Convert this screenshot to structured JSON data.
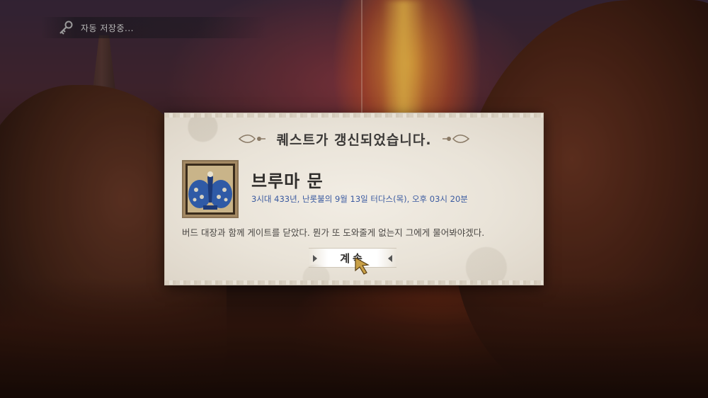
{
  "autosave": {
    "text": "자동 저장중...",
    "icon": "key-icon"
  },
  "dialog": {
    "title": "퀘스트가 갱신되었습니다.",
    "quest_name": "브루마 문",
    "date": "3시대 433년, 난롯불의 9월 13일 터다스(목), 오후 03시 20분",
    "description": "버드 대장과 함께 게이트를 닫았다. 뭔가 또 도와줄게 없는지 그에게 물어봐야겠다.",
    "emblem_icon": "peacock-crest-icon",
    "continue_label": "계속"
  },
  "colors": {
    "parchment": "#ebe6dc",
    "title_text": "#3c3a38",
    "date_text": "#3a5aa0",
    "emblem_blue": "#2f5aa6",
    "emblem_gold": "#b89a62"
  }
}
